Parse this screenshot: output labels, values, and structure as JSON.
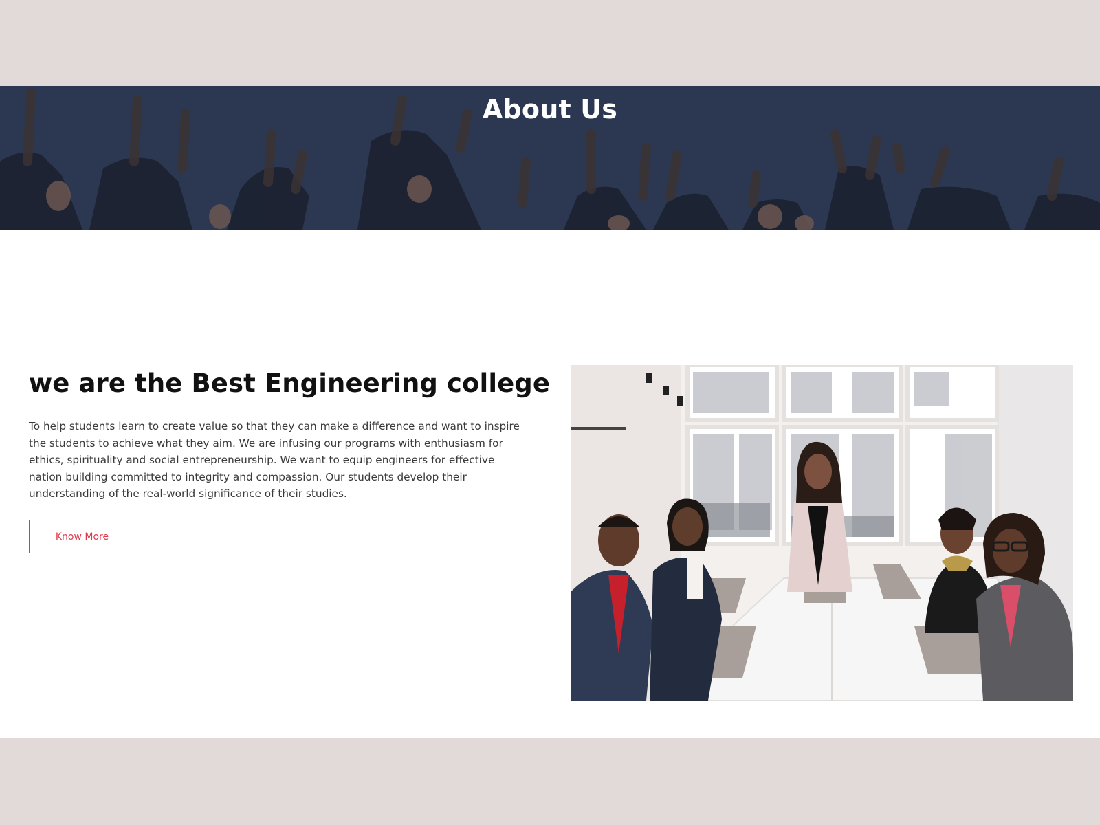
{
  "hero": {
    "title": "About Us",
    "background_color": "#2c3852"
  },
  "about": {
    "headline": "we are the Best Engineering college",
    "paragraph": "To help students learn to create value so that they can make a difference and want to inspire the students to achieve what they aim. We are infusing our programs with enthusiasm for ethics, spirituality and social entrepreneurship. We want to equip engineers for effective nation building committed to integrity and compassion. Our students develop their understanding of the real-world significance of their studies.",
    "button_label": "Know More",
    "accent_color": "#e0394b"
  },
  "page": {
    "outer_background": "#e2dad9"
  }
}
